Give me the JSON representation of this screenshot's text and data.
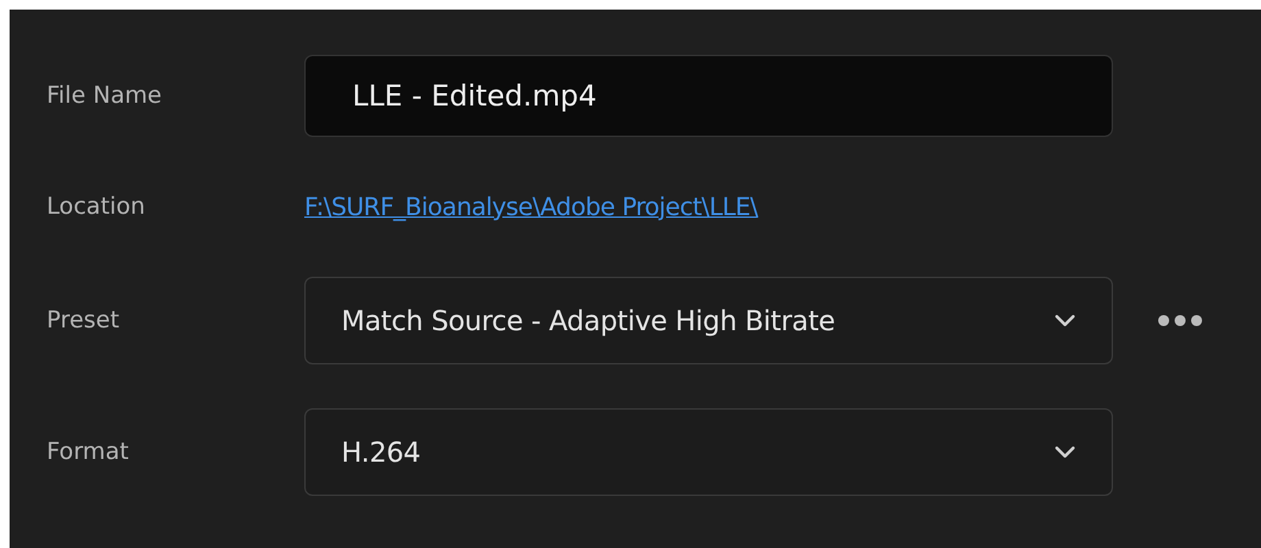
{
  "fields": [
    {
      "kind": "text",
      "label": "File Name",
      "value": "LLE - Edited.mp4"
    },
    {
      "kind": "link",
      "label": "Location",
      "value": "F:\\SURF_Bioanalyse\\Adobe Project\\LLE\\"
    },
    {
      "kind": "dropdown",
      "label": "Preset",
      "value": "Match Source - Adaptive High Bitrate",
      "more": true
    },
    {
      "kind": "dropdown",
      "label": "Format",
      "value": "H.264",
      "more": false
    }
  ]
}
